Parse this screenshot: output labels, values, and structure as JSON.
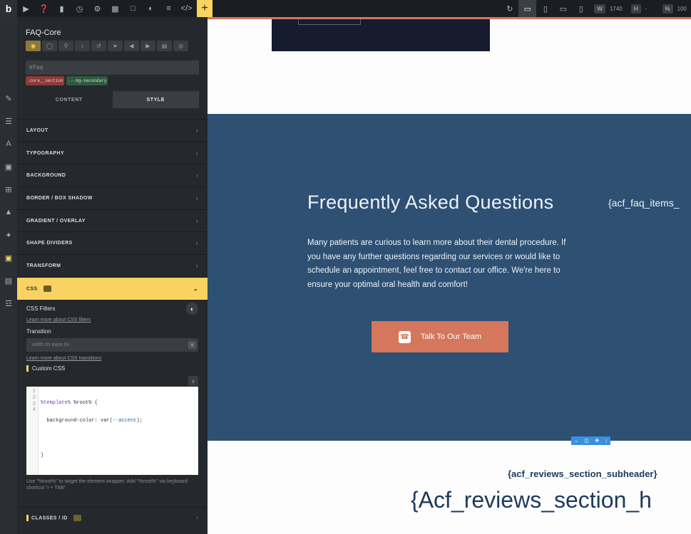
{
  "toolbar": {
    "logo": "b",
    "width_label": "W",
    "width_value": "1740",
    "height_label": "H",
    "height_value": "-",
    "zoom_label": "%",
    "zoom_value": "100",
    "plus": "+"
  },
  "panel": {
    "element_title": "FAQ-Core",
    "selector": "#faq",
    "classes": [
      ".core__section",
      ".--bg-secondary"
    ],
    "tabs": [
      "CONTENT",
      "STYLE"
    ],
    "active_tab": "STYLE",
    "sections": [
      "LAYOUT",
      "TYPOGRAPHY",
      "BACKGROUND",
      "BORDER / BOX SHADOW",
      "GRADIENT / OVERLAY",
      "SHAPE DIVIDERS",
      "TRANSFORM"
    ],
    "css_section": "CSS",
    "css_filters_label": "CSS Filters",
    "css_filters_link": "Learn more about CSS filters",
    "transition_label": "Transition",
    "transition_placeholder": "width 0s ease 0s",
    "transition_link": "Learn more about CSS transitions",
    "custom_css_label": "Custom CSS",
    "code_line_numbers": [
      "1",
      "2",
      "3",
      "4"
    ],
    "code_line1_a": "%template%",
    "code_line1_b": " %root% {",
    "code_line2_a": "  background-color: var(",
    "code_line2_b": "--accent",
    "code_line2_c": ");",
    "code_line4": "}",
    "hint": "Use \"%root%\" to target the element wrapper. Add \"%root%\" via keyboard shortcut \"r + TAB\".",
    "classes_section": "CLASSES / ID"
  },
  "canvas": {
    "faq_title": "Frequently Asked Questions",
    "faq_side_text": "{acf_faq_items_",
    "faq_paragraph": "Many patients are curious to learn more about their dental procedure. If you have any further questions regarding our services or would like to schedule an appointment, feel free to contact our office. We're here to ensure your optimal oral health and comfort!",
    "cta_label": "Talk To Our Team",
    "reviews_subheader": "{acf_reviews_section_subheader}",
    "reviews_header": "{Acf_reviews_section_h"
  },
  "colors": {
    "accent": "#f8d361",
    "faq_bg": "#2d5073",
    "cta": "#d4775c",
    "panel_bg": "#25282c"
  }
}
